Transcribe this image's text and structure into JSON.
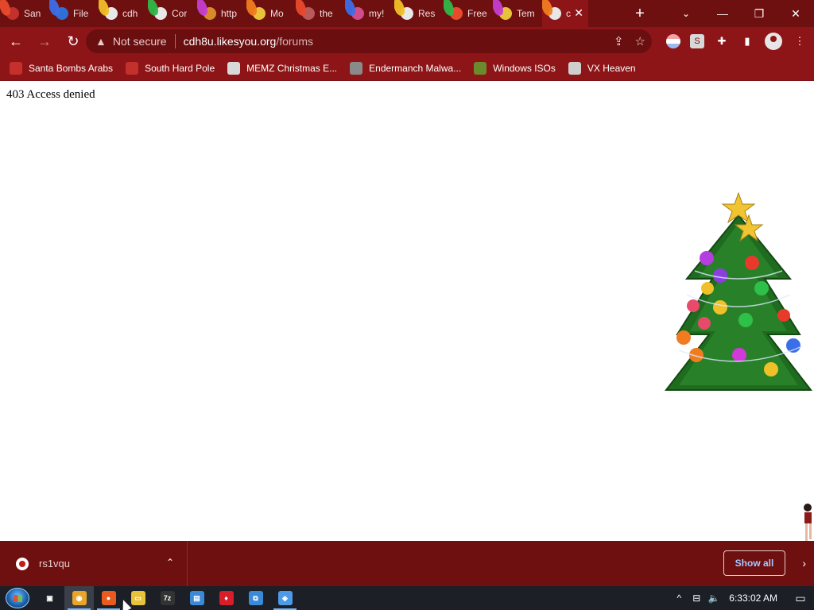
{
  "browser": {
    "tabs": [
      {
        "label": "San",
        "icon": "santa-icon",
        "color": "#c4302b"
      },
      {
        "label": "File",
        "icon": "file-icon",
        "color": "#2f6fd6"
      },
      {
        "label": "cdh",
        "icon": "globe-icon",
        "color": "#e8e8e8"
      },
      {
        "label": "Cor",
        "icon": "globe-icon",
        "color": "#e8e8e8"
      },
      {
        "label": "http",
        "icon": "puzzle-icon",
        "color": "#d98b2b"
      },
      {
        "label": "Mo",
        "icon": "map-pin-icon",
        "color": "#e8c23a"
      },
      {
        "label": "the",
        "icon": "image-icon",
        "color": "#b85a5a"
      },
      {
        "label": "my!",
        "icon": "sparkle-icon",
        "color": "#d14d8a"
      },
      {
        "label": "Res",
        "icon": "globe-icon",
        "color": "#e8e8e8"
      },
      {
        "label": "Free",
        "icon": "bulb-icon",
        "color": "#e84b2c"
      },
      {
        "label": "Tem",
        "icon": "envelope-icon",
        "color": "#e8c23a"
      },
      {
        "label": "c",
        "icon": "globe-icon",
        "color": "#e8e8e8",
        "active": true
      }
    ],
    "new_tab_label": "+",
    "tab_search_label": "⌄",
    "window_controls": {
      "minimize": "—",
      "restore": "❐",
      "close": "✕"
    },
    "lights_colors": [
      "#e84b2c",
      "#3b6fe8",
      "#f0c028",
      "#2fb84a",
      "#c43fd1",
      "#f07c1f"
    ]
  },
  "toolbar": {
    "back": "←",
    "forward": "→",
    "reload": "↻",
    "security_icon": "▲",
    "security_label": "Not secure",
    "url_host": "cdh8u.likesyou.org",
    "url_path": "/forums",
    "share": "⇪",
    "bookmark_star": "☆",
    "ext_s": "S",
    "extensions": "✚",
    "sidepanel": "▮",
    "menu": "⋮"
  },
  "bookmarks": [
    {
      "label": "Santa Bombs Arabs",
      "icon": "santa-icon",
      "color": "#c4302b"
    },
    {
      "label": "South Hard Pole",
      "icon": "snowflake-icon",
      "color": "#c4302b"
    },
    {
      "label": "MEMZ Christmas E...",
      "icon": "memz-icon",
      "color": "#d8d8d8"
    },
    {
      "label": "Endermanch Malwa...",
      "icon": "raccoon-icon",
      "color": "#8a8a8a"
    },
    {
      "label": "Windows ISOs",
      "icon": "tree-icon",
      "color": "#6b8a2e"
    },
    {
      "label": "VX Heaven",
      "icon": "vx-icon",
      "color": "#cfcfcf"
    }
  ],
  "page": {
    "message": "403 Access denied"
  },
  "downloads": {
    "file_name": "rs1vqu",
    "caret": "⌃",
    "show_all_label": "Show all",
    "close": "›"
  },
  "taskbar": {
    "apps": [
      {
        "name": "task-view-icon",
        "glyph": "▣",
        "color": "#1c1f26"
      },
      {
        "name": "chrome-icon",
        "glyph": "◉",
        "color": "#e8a52a",
        "active": true,
        "running": true
      },
      {
        "name": "firefox-icon",
        "glyph": "●",
        "color": "#e85a1e",
        "running": true
      },
      {
        "name": "file-explorer-icon",
        "glyph": "▭",
        "color": "#e8c23a"
      },
      {
        "name": "7zip-icon",
        "glyph": "7z",
        "color": "#333333"
      },
      {
        "name": "window-app-icon",
        "glyph": "▤",
        "color": "#3a8ad8"
      },
      {
        "name": "flame-app-icon",
        "glyph": "♦",
        "color": "#d81e2a"
      },
      {
        "name": "network-app-icon",
        "glyph": "⧉",
        "color": "#3a8ad8"
      },
      {
        "name": "shield-app-icon",
        "glyph": "◈",
        "color": "#4d9ae8",
        "running": true
      }
    ],
    "tray_chevron": "^",
    "network": "⊟",
    "volume": "🔈",
    "time": "6:33:02 AM",
    "notifications": "▭"
  }
}
